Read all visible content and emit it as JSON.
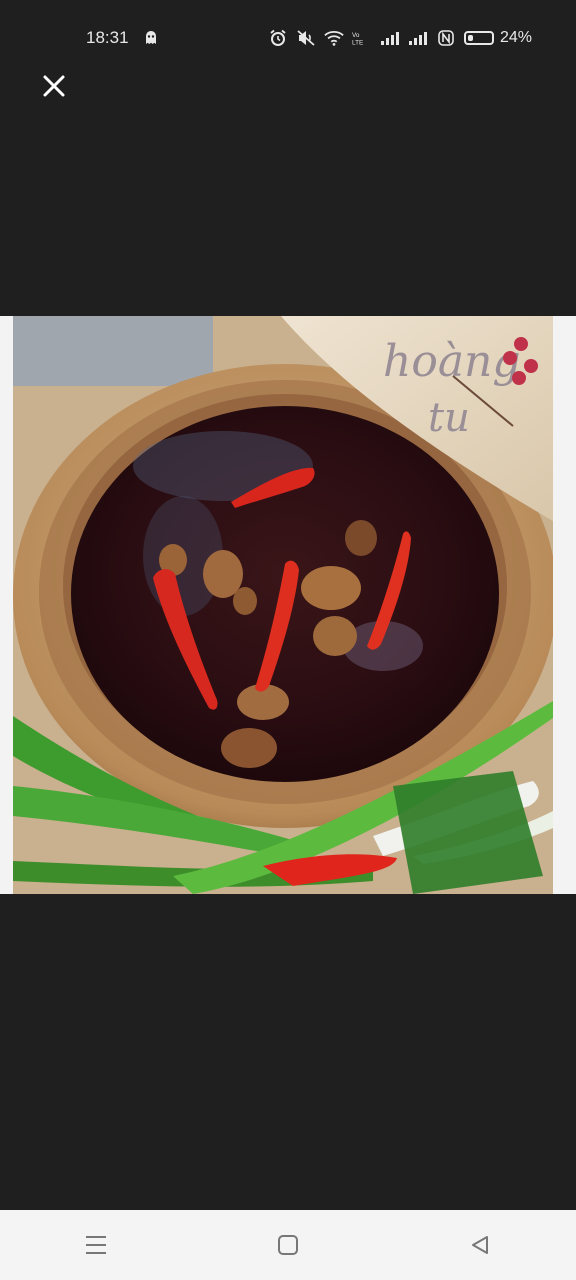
{
  "status_bar": {
    "time": "18:31",
    "battery_percent_text": "24%",
    "battery_level": 0.24,
    "icons": [
      "ghost-icon",
      "alarm-icon",
      "mute-icon",
      "wifi-icon",
      "volte-icon",
      "signal-icon",
      "signal-icon",
      "nfc-icon",
      "battery-icon"
    ]
  },
  "viewer": {
    "close_icon": "close-icon",
    "image": {
      "description_icon": "food-photo",
      "watermark_lines": [
        "hoàng",
        "tu"
      ]
    }
  },
  "nav_bar": {
    "buttons": [
      "menu-icon",
      "home-icon",
      "back-icon"
    ]
  },
  "colors": {
    "background": "#1f1f1f",
    "nav_background": "#f4f4f4",
    "status_text": "#e8e8e8"
  }
}
